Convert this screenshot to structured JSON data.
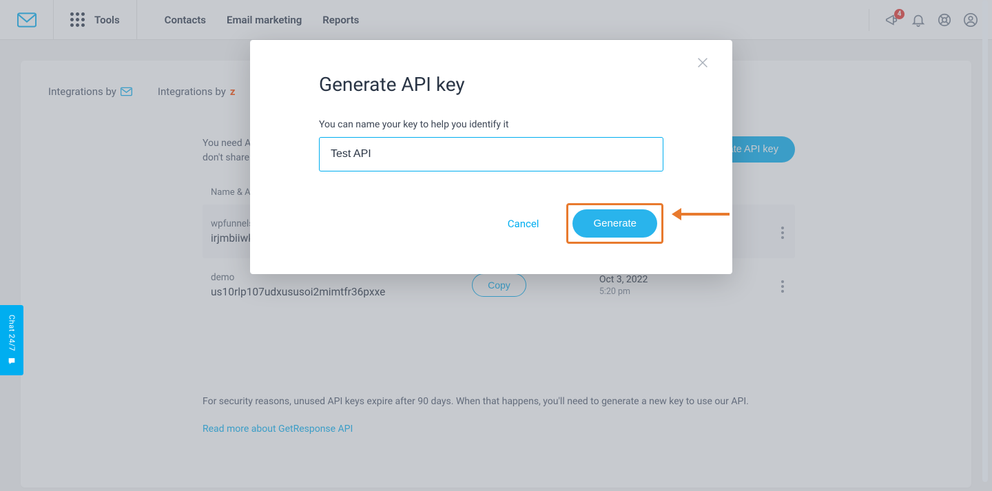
{
  "nav": {
    "tools": "Tools",
    "links": [
      "Contacts",
      "Email marketing",
      "Reports"
    ],
    "notif_count": "4"
  },
  "page": {
    "tab1": "Integrations by",
    "tab2": "Integrations by",
    "zapier_mark": "z",
    "api_info": "You need API keys to use the GetResponse API. Protect your API key like a password – don't share it with anyone.",
    "generate_btn": "Generate API key",
    "col_name": "Name & API key",
    "rows": [
      {
        "name": "wpfunnels",
        "key": "irjmbiiwk",
        "date": "",
        "time": ""
      },
      {
        "name": "demo",
        "key": "us10rlp107udxususoi2mimtfr36pxxe",
        "date": "Oct 3, 2022",
        "time": "5:20 pm"
      }
    ],
    "copy": "Copy",
    "footnote": "For security reasons, unused API keys expire after 90 days. When that happens, you'll need to generate a new key to use our API.",
    "footlink": "Read more about GetResponse API"
  },
  "modal": {
    "title": "Generate API key",
    "label": "You can name your key to help you identify it",
    "input_value": "Test API",
    "cancel": "Cancel",
    "generate": "Generate"
  },
  "chat": {
    "label": "Chat 24/7"
  }
}
